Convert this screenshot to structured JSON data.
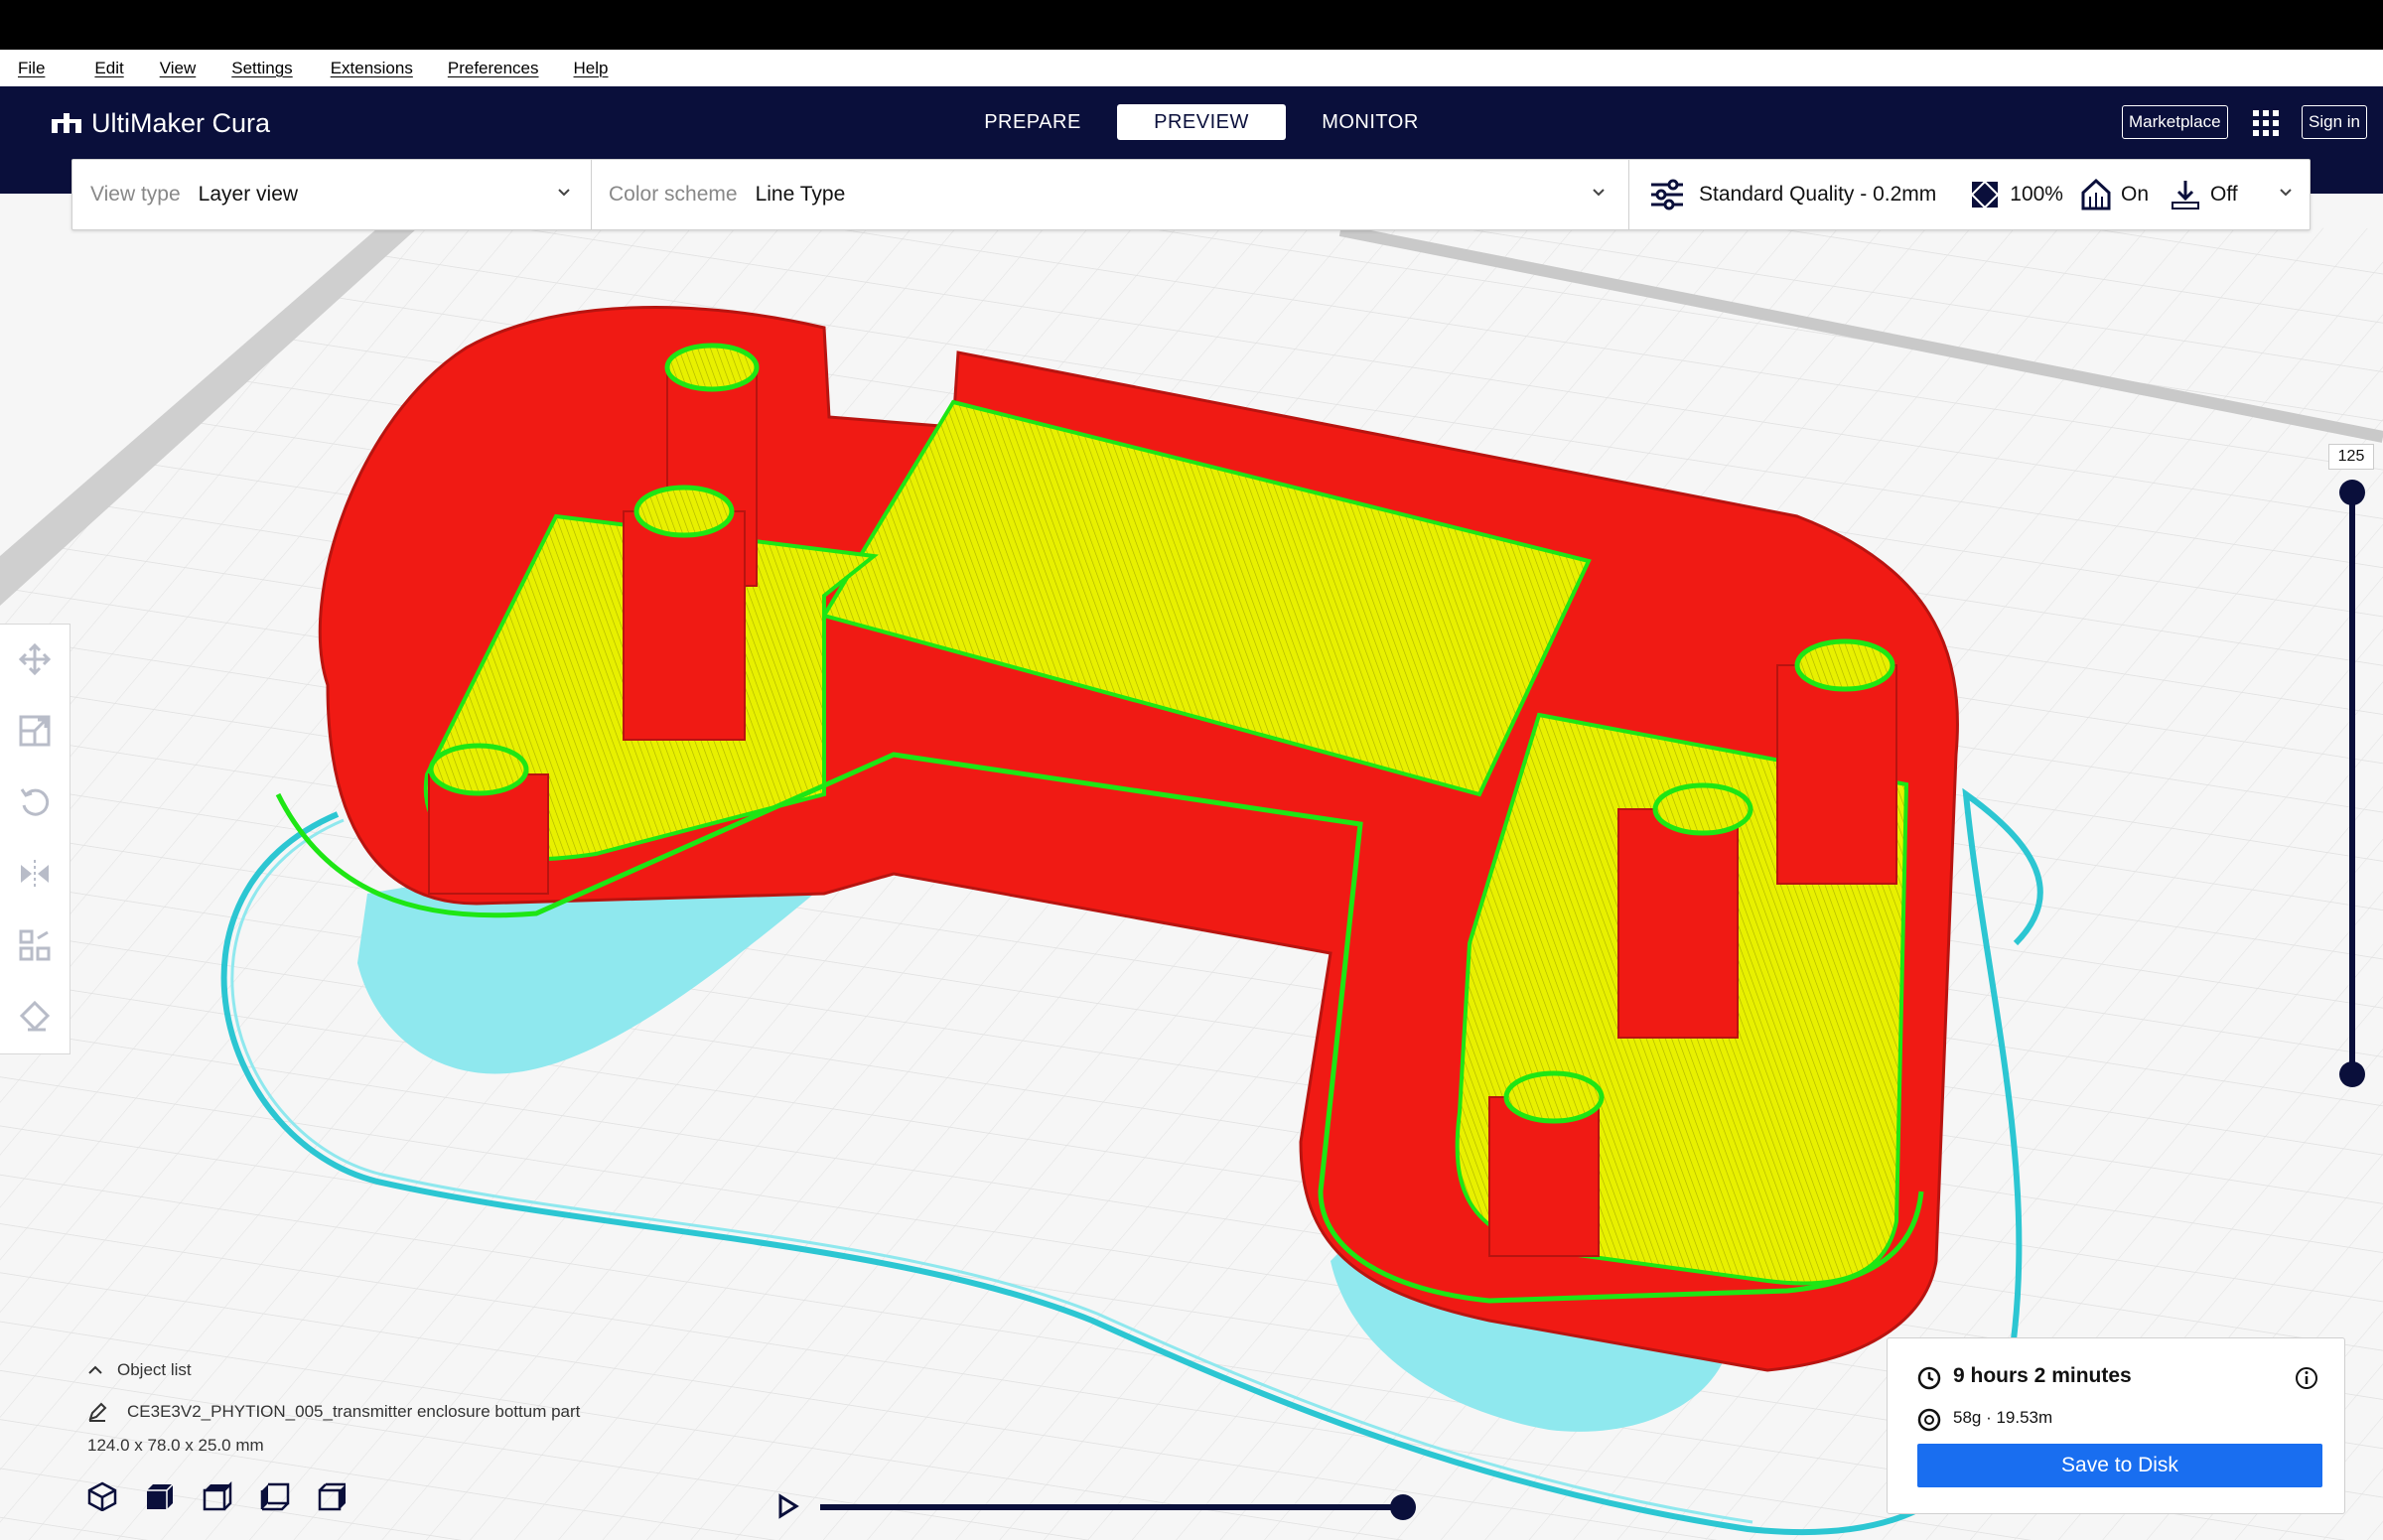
{
  "menu": [
    "File",
    "Edit",
    "View",
    "Settings",
    "Extensions",
    "Preferences",
    "Help"
  ],
  "app": {
    "title": "UltiMaker Cura"
  },
  "tabs": [
    "PREPARE",
    "PREVIEW",
    "MONITOR"
  ],
  "active_tab": "PREVIEW",
  "header_buttons": {
    "marketplace": "Marketplace",
    "signin": "Sign in"
  },
  "toolbar": {
    "view_type_label": "View type",
    "view_type_value": "Layer view",
    "color_scheme_label": "Color scheme",
    "color_scheme_value": "Line Type",
    "quality": "Standard Quality - 0.2mm",
    "infill": "100%",
    "support": "On",
    "adhesion": "Off"
  },
  "layer_slider": {
    "value": "125"
  },
  "object_list": {
    "title": "Object list",
    "object_name": "CE3E3V2_PHYTION_005_transmitter enclosure bottum part",
    "dimensions": "124.0 x 78.0 x 25.0 mm"
  },
  "print_info": {
    "time": "9 hours 2 minutes",
    "material": "58g · 19.53m",
    "save_button": "Save to Disk"
  },
  "colors": {
    "header": "#0a0f3b",
    "accent": "#196ef0",
    "wall_red": "#f01a14",
    "infill_yellow": "#e8f000",
    "inner_wall_green": "#1ee614",
    "support_cyan": "#4de1e6"
  }
}
